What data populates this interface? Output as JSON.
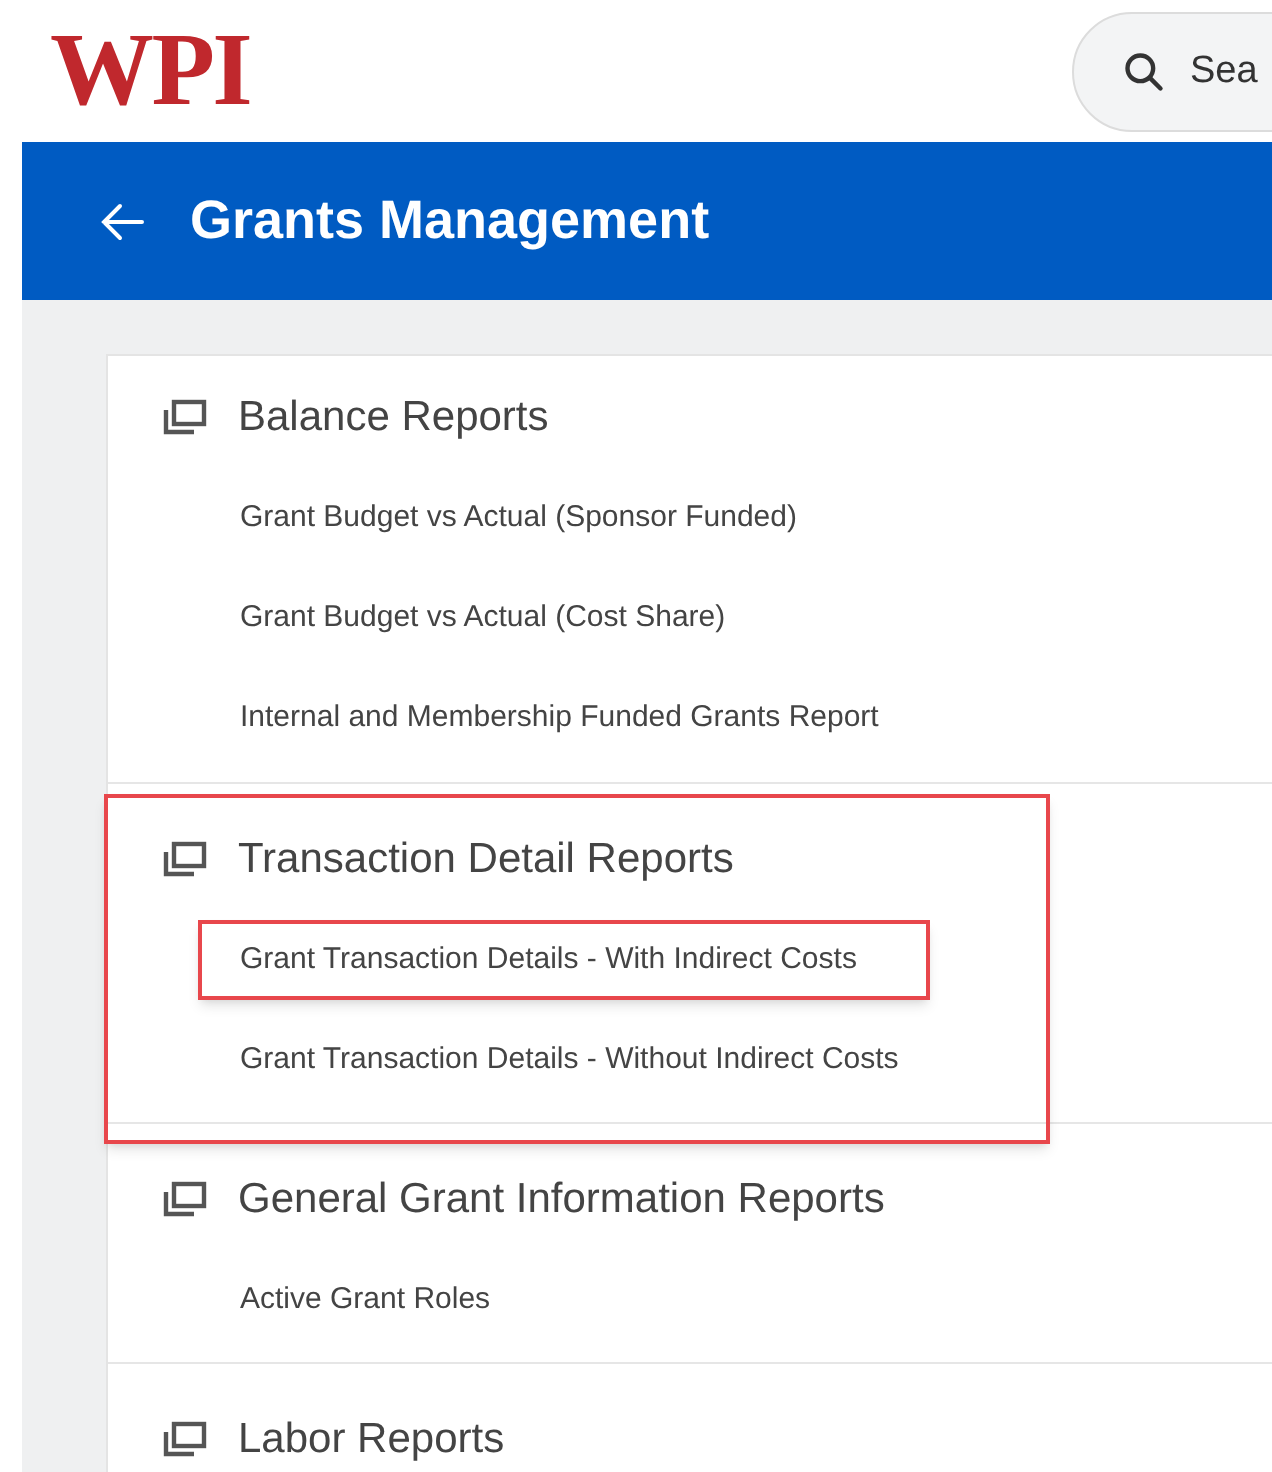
{
  "logo": "WPI",
  "search": {
    "placeholder": "Sea"
  },
  "header": {
    "title": "Grants Management"
  },
  "sections": [
    {
      "title": "Balance Reports",
      "highlighted": false,
      "items": [
        {
          "label": "Grant Budget vs Actual (Sponsor Funded)",
          "highlighted": false
        },
        {
          "label": "Grant Budget vs Actual (Cost Share)",
          "highlighted": false
        },
        {
          "label": "Internal and Membership Funded Grants Report",
          "highlighted": false
        }
      ]
    },
    {
      "title": "Transaction Detail Reports",
      "highlighted": true,
      "items": [
        {
          "label": "Grant Transaction Details - With Indirect Costs",
          "highlighted": true
        },
        {
          "label": "Grant Transaction Details - Without Indirect Costs",
          "highlighted": false
        }
      ]
    },
    {
      "title": "General Grant Information Reports",
      "highlighted": false,
      "items": [
        {
          "label": "Active Grant Roles",
          "highlighted": false
        }
      ]
    },
    {
      "title": "Labor Reports",
      "highlighted": false
    }
  ]
}
